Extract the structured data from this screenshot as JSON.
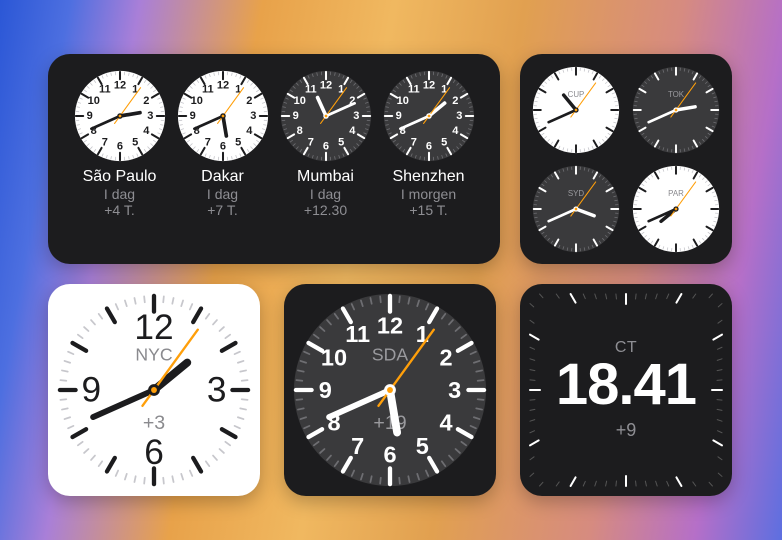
{
  "localHour": 10,
  "localMinute": 41,
  "widgets": {
    "world_clocks": [
      {
        "city": "São Paulo",
        "day": "I dag",
        "offset": "+4 T.",
        "face": "light",
        "hour": 14,
        "minute": 41
      },
      {
        "city": "Dakar",
        "day": "I dag",
        "offset": "+7 T.",
        "face": "light",
        "hour": 17,
        "minute": 41
      },
      {
        "city": "Mumbai",
        "day": "I dag",
        "offset": "+12.30",
        "face": "dark",
        "hour": 23,
        "minute": 11
      },
      {
        "city": "Shenzhen",
        "day": "I morgen",
        "offset": "+15 T.",
        "face": "dark",
        "hour": 1,
        "minute": 41
      }
    ],
    "grid_clocks": [
      {
        "abbr": "CUP",
        "face": "light",
        "hour": 10,
        "minute": 41
      },
      {
        "abbr": "TOK",
        "face": "dark",
        "hour": 2,
        "minute": 41
      },
      {
        "abbr": "SYD",
        "face": "dark",
        "hour": 3,
        "minute": 41
      },
      {
        "abbr": "PAR",
        "face": "light",
        "hour": 19,
        "minute": 41
      }
    ],
    "large_light": {
      "abbr": "NYC",
      "offset": "+3",
      "face": "light",
      "square": true,
      "hour": 13,
      "minute": 41
    },
    "large_dark": {
      "abbr": "SDA",
      "offset": "+19",
      "face": "dark",
      "square": false,
      "hour": 5,
      "minute": 41
    },
    "digital": {
      "abbr": "CT",
      "time": "18.41",
      "offset": "+9"
    }
  }
}
